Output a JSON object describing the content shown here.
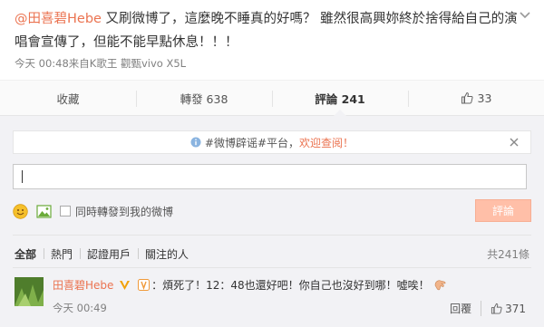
{
  "post": {
    "mention": "@田喜碧Hebe",
    "text": " 又刷微博了，這麼晚不睡真的好嗎？ 雖然很高興妳終於捨得給自己的演唱會宣傳了，但能不能早點休息！！！",
    "meta": "今天 00:48来自K歌王 觀甄vivo X5L"
  },
  "actions": {
    "collect": "收藏",
    "forward": "轉發 638",
    "comment": "評論 241",
    "like": "33"
  },
  "notice": {
    "hash": "#微博辟谣#平台，",
    "welcome": "欢迎查阅！"
  },
  "composer": {
    "input_value": "",
    "checkbox_label": "同時轉發到我的微博",
    "submit_label": "評論"
  },
  "filters": {
    "items": [
      "全部",
      "熱門",
      "認證用戶",
      "關注的人"
    ],
    "total": "共241條"
  },
  "comment": {
    "user": "田喜碧Hebe",
    "text": "：煩死了！12：48也還好吧！你自己也沒好到哪！噓唉！",
    "time": "今天 00:49",
    "reply": "回覆",
    "likes": "371"
  },
  "colors": {
    "accent": "#eb7350",
    "button_disabled": "#ffbfa8",
    "background": "#f2f2f5"
  }
}
